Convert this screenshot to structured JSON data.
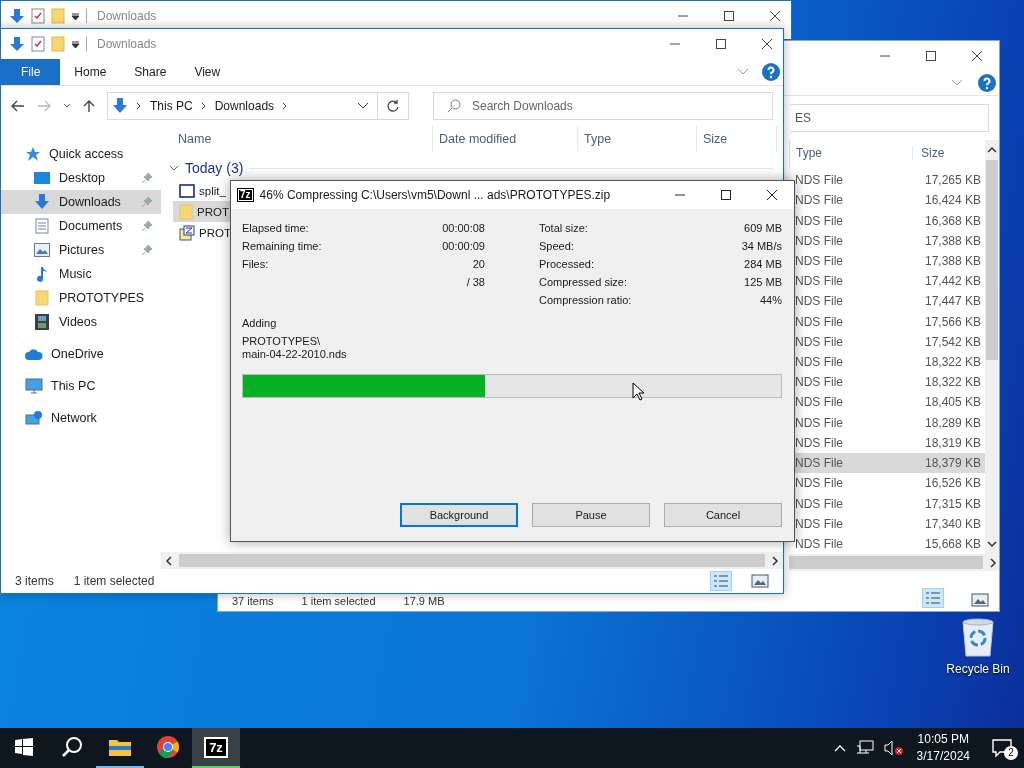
{
  "desktop": {
    "icons": [
      {
        "label": "Recycle Bin"
      }
    ]
  },
  "back_window_top": {
    "title": "Downloads"
  },
  "back_window_right": {
    "search_text": "ES",
    "columns": [
      "Type",
      "Size"
    ],
    "rows": [
      {
        "type": "NDS File",
        "size": "17,265 KB",
        "selected": false
      },
      {
        "type": "NDS File",
        "size": "16,424 KB",
        "selected": false
      },
      {
        "type": "NDS File",
        "size": "16,368 KB",
        "selected": false
      },
      {
        "type": "NDS File",
        "size": "17,388 KB",
        "selected": false
      },
      {
        "type": "NDS File",
        "size": "17,388 KB",
        "selected": false
      },
      {
        "type": "NDS File",
        "size": "17,442 KB",
        "selected": false
      },
      {
        "type": "NDS File",
        "size": "17,447 KB",
        "selected": false
      },
      {
        "type": "NDS File",
        "size": "17,566 KB",
        "selected": false
      },
      {
        "type": "NDS File",
        "size": "17,542 KB",
        "selected": false
      },
      {
        "type": "NDS File",
        "size": "18,322 KB",
        "selected": false
      },
      {
        "type": "NDS File",
        "size": "18,322 KB",
        "selected": false
      },
      {
        "type": "NDS File",
        "size": "18,405 KB",
        "selected": false
      },
      {
        "type": "NDS File",
        "size": "18,289 KB",
        "selected": false
      },
      {
        "type": "NDS File",
        "size": "18,319 KB",
        "selected": false
      },
      {
        "type": "NDS File",
        "size": "18,379 KB",
        "selected": true
      },
      {
        "type": "NDS File",
        "size": "16,526 KB",
        "selected": false
      },
      {
        "type": "NDS File",
        "size": "17,315 KB",
        "selected": false
      },
      {
        "type": "NDS File",
        "size": "17,340 KB",
        "selected": false
      },
      {
        "type": "NDS File",
        "size": "15,668 KB",
        "selected": false
      }
    ],
    "status": [
      "37 items",
      "1 item selected",
      "17.9 MB"
    ]
  },
  "explorer": {
    "title": "Downloads",
    "ribbon_tabs": [
      {
        "label": "File",
        "selected": true
      },
      {
        "label": "Home",
        "selected": false
      },
      {
        "label": "Share",
        "selected": false
      },
      {
        "label": "View",
        "selected": false
      }
    ],
    "breadcrumbs": [
      "This PC",
      "Downloads"
    ],
    "search": {
      "placeholder": "Search Downloads"
    },
    "sidebar": {
      "items": [
        {
          "label": "Quick access",
          "kind": "star",
          "children": [
            {
              "label": "Desktop",
              "kind": "desktop",
              "pinned": true,
              "selected": false
            },
            {
              "label": "Downloads",
              "kind": "download",
              "pinned": true,
              "selected": true
            },
            {
              "label": "Documents",
              "kind": "documents",
              "pinned": true,
              "selected": false
            },
            {
              "label": "Pictures",
              "kind": "pictures",
              "pinned": true,
              "selected": false
            },
            {
              "label": "Music",
              "kind": "music",
              "pinned": false,
              "selected": false
            },
            {
              "label": "PROTOTYPES",
              "kind": "folder",
              "pinned": false,
              "selected": false
            },
            {
              "label": "Videos",
              "kind": "videos",
              "pinned": false,
              "selected": false
            }
          ]
        },
        {
          "label": "OneDrive",
          "kind": "cloud"
        },
        {
          "label": "This PC",
          "kind": "pc"
        },
        {
          "label": "Network",
          "kind": "network"
        }
      ]
    },
    "columns": [
      "Name",
      "Date modified",
      "Type",
      "Size"
    ],
    "group": "Today (3)",
    "files": [
      {
        "name": "split_",
        "kind": "window",
        "selected": false
      },
      {
        "name": "PROT",
        "kind": "folder",
        "selected": true
      },
      {
        "name": "PROT",
        "kind": "archive",
        "selected": false
      }
    ],
    "status": {
      "count": "3 items",
      "selection": "1 item selected"
    }
  },
  "dialog": {
    "icon_text": "7z",
    "title": "46% Compressing C:\\Users\\vm5\\Downl ... ads\\PROTOTYPES.zip",
    "left_stats": [
      {
        "label": "Elapsed time:",
        "value": "00:00:08"
      },
      {
        "label": "Remaining time:",
        "value": "00:00:09"
      },
      {
        "label": "Files:",
        "value": "20"
      },
      {
        "value": "/ 38"
      }
    ],
    "right_stats": [
      {
        "label": "Total size:",
        "value": "609 MB"
      },
      {
        "label": "Speed:",
        "value": "34 MB/s"
      },
      {
        "label": "Processed:",
        "value": "284 MB"
      },
      {
        "label": "Compressed size:",
        "value": "125 MB"
      },
      {
        "label": "Compression ratio:",
        "value": "44%"
      }
    ],
    "action": "Adding",
    "current_file": [
      "PROTOTYPES\\",
      "main-04-22-2010.nds"
    ],
    "progress": {
      "level": 0.45
    },
    "buttons": [
      {
        "label": "Background",
        "selected": true
      },
      {
        "label": "Pause",
        "selected": false
      },
      {
        "label": "Cancel",
        "selected": false
      }
    ]
  },
  "taskbar": {
    "apps": [
      {
        "kind": "start",
        "running": false,
        "selected": false
      },
      {
        "kind": "search",
        "running": false,
        "selected": false
      },
      {
        "kind": "explorer",
        "running": true,
        "selected": false
      },
      {
        "kind": "chrome",
        "running": false,
        "selected": false
      },
      {
        "kind": "sevenzip",
        "label": "7z",
        "running": true,
        "selected": true
      }
    ],
    "tray": {
      "time": "10:05 PM",
      "date": "3/17/2024",
      "notifications": "2"
    }
  }
}
